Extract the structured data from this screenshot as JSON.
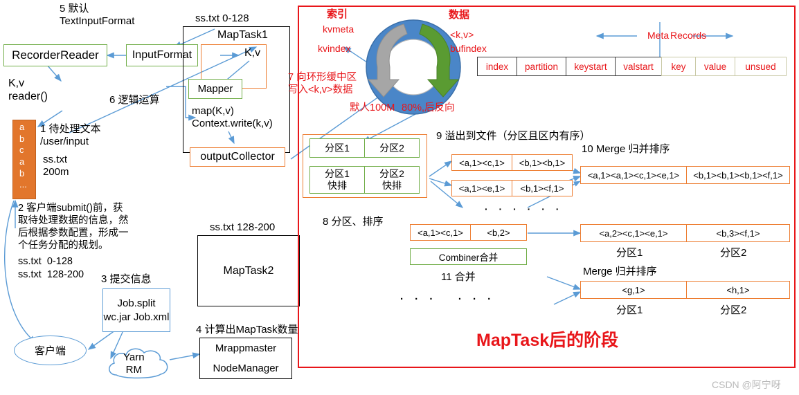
{
  "meta": {
    "watermark": "CSDN @阿宁呀",
    "colors": {
      "green": "#70ad47",
      "orange": "#ed7d31",
      "blue": "#5b9bd5",
      "red": "#e8161a",
      "ring_blue": "#4a86c8",
      "arrow_gray": "#a6a6a6",
      "arrow_green": "#70ad47"
    }
  },
  "left": {
    "label_5": "5 默认\nTextInputFormat",
    "recorder_reader": "RecorderReader",
    "input_format": "InputFormat",
    "kv_reader": "K,v\nreader()",
    "label_6": "6 逻辑运算",
    "file_chars": [
      "a",
      "b",
      "c",
      "a",
      "b",
      "..."
    ],
    "label_1": "1 待处理文本\n/user/input",
    "label_1b": "ss.txt\n200m",
    "label_2": "2 客户端submit()前，获\n取待处理数据的信息，然\n后根据参数配置，形成一\n个任务分配的规划。",
    "split_1": "ss.txt  0-128",
    "split_2": "ss.txt  128-200",
    "label_3": "3 提交信息",
    "job_box": "Job.split\nwc.jar\nJob.xml",
    "client": "客户端",
    "yarn": "Yarn\nRM",
    "label_4": "4 计算出MapTask数量",
    "mrappmaster": "Mrappmaster",
    "nodemanager": "NodeManager"
  },
  "maptask1": {
    "caption": "ss.txt 0-128",
    "title": "MapTask1",
    "kv": "K,v",
    "mapper": "Mapper",
    "map_calls": "map(K,v)\nContext.write(k,v)",
    "output_collector": "outputCollector"
  },
  "maptask2": {
    "caption": "ss.txt 128-200",
    "title": "MapTask2"
  },
  "ring": {
    "index_title": "索引",
    "kvmeta": "kvmeta",
    "kvindex": "kvindex",
    "data_title": "数据",
    "kv": "<k,v>",
    "bufindex": "bufindex",
    "label_7": "7 向环形缓中区\n写入<k,v>数据",
    "default_size": "默人100M",
    "threshold": "80%,后反向"
  },
  "buffer_table": {
    "meta_label": "Meta",
    "records_label": "Records",
    "meta_cells": [
      "index",
      "partition",
      "keystart",
      "valstart"
    ],
    "record_cells": [
      "key",
      "value",
      "unsued"
    ]
  },
  "partition_sort": {
    "row1": [
      "分区1",
      "分区2"
    ],
    "row2": [
      "分区1\n快排",
      "分区2\n快排"
    ],
    "caption": "8 分区、排序"
  },
  "spill": {
    "caption": "9 溢出到文件（分区且区内有序）",
    "file1": [
      "<a,1><c,1>",
      "<b,1><b,1>"
    ],
    "file2": [
      "<a,1><e,1>",
      "<b,1><f,1>"
    ],
    "dots": "· · · · · ·"
  },
  "merge": {
    "caption": "10 Merge 归并排序",
    "row": [
      "<a,1><a,1><c,1><e,1>",
      "<b,1><b,1><b,1><f,1>"
    ]
  },
  "combiner": {
    "row": [
      "<a,1><c,1>",
      "<b,2>"
    ],
    "bar": "Combiner合并",
    "caption": "11 合并"
  },
  "final": {
    "merge1": [
      "<a,2><c,1><e,1>",
      "<b,3><f,1>"
    ],
    "part_labels_1": [
      "分区1",
      "分区2"
    ],
    "merge_caption": "Merge 归并排序",
    "merge2": [
      "<g,1>",
      "<h,1>"
    ],
    "part_labels_2": [
      "分区1",
      "分区2"
    ],
    "dots_bottom": "· · ·   · · ·",
    "stage_title": "MapTask后的阶段"
  }
}
